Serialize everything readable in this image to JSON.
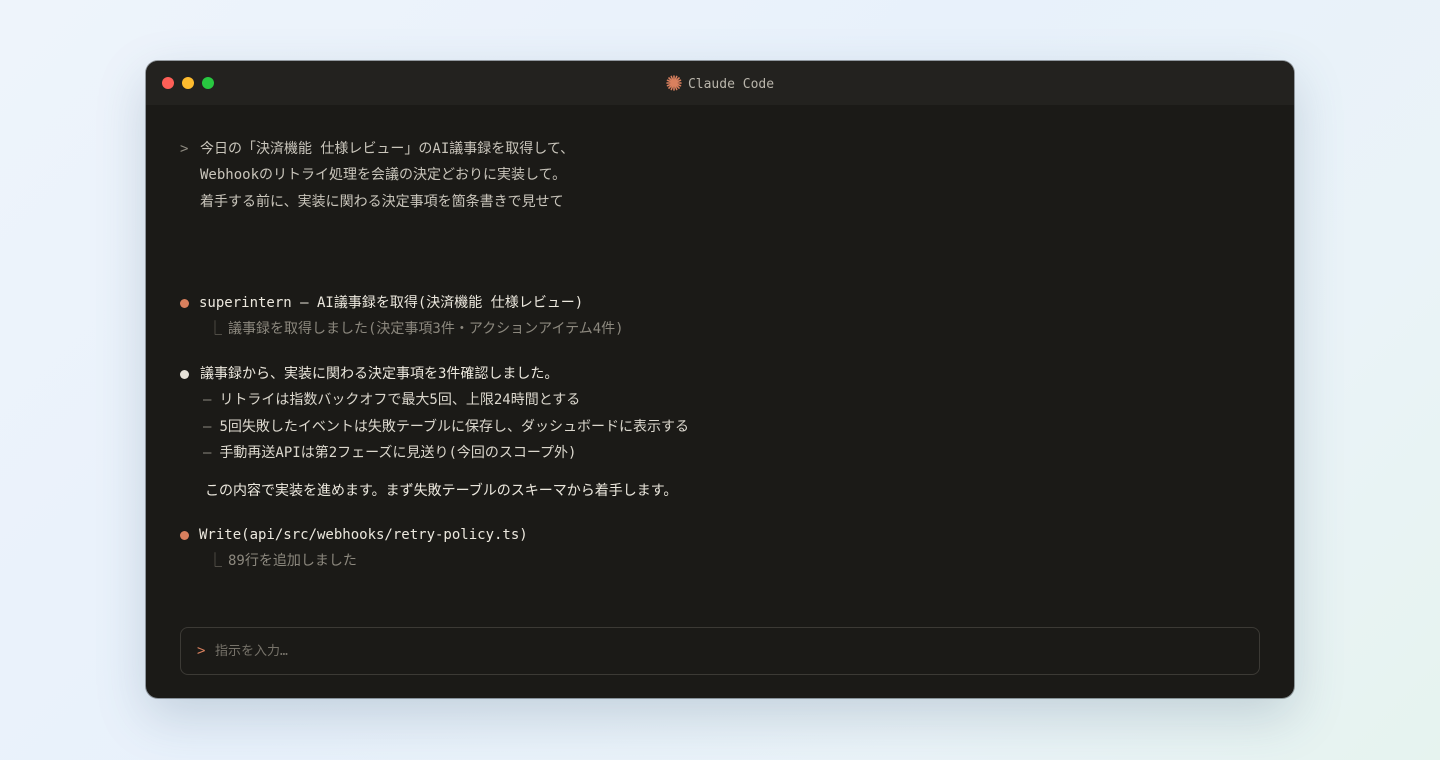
{
  "window": {
    "title": "Claude Code",
    "logo_icon": "sparkle-icon",
    "accent_color": "#d9805e"
  },
  "prompt": {
    "marker": ">",
    "lines": [
      "今日の「決済機能 仕様レビュー」のAI議事録を取得して、",
      "Webhookのリトライ処理を会議の決定どおりに実装して。",
      "着手する前に、実装に関わる決定事項を箇条書きで見せて"
    ]
  },
  "tool_call_1": {
    "label": "superintern – AI議事録を取得(決済機能 仕様レビュー)",
    "result_elbow": "⎿",
    "result": "議事録を取得しました(決定事項3件・アクションアイテム4件)"
  },
  "message": {
    "text": "議事録から、実装に関わる決定事項を3件確認しました。",
    "dash": "–",
    "items": [
      "リトライは指数バックオフで最大5回、上限24時間とする",
      "5回失敗したイベントは失敗テーブルに保存し、ダッシュボードに表示する",
      "手動再送APIは第2フェーズに見送り(今回のスコープ外)"
    ],
    "follow_up": "この内容で実装を進めます。まず失敗テーブルのスキーマから着手します。"
  },
  "tool_call_2": {
    "label": "Write(api/src/webhooks/retry-policy.ts)",
    "result_elbow": "⎿",
    "result": "89行を追加しました"
  },
  "input": {
    "caret": ">",
    "placeholder": "指示を入力…",
    "value": ""
  }
}
